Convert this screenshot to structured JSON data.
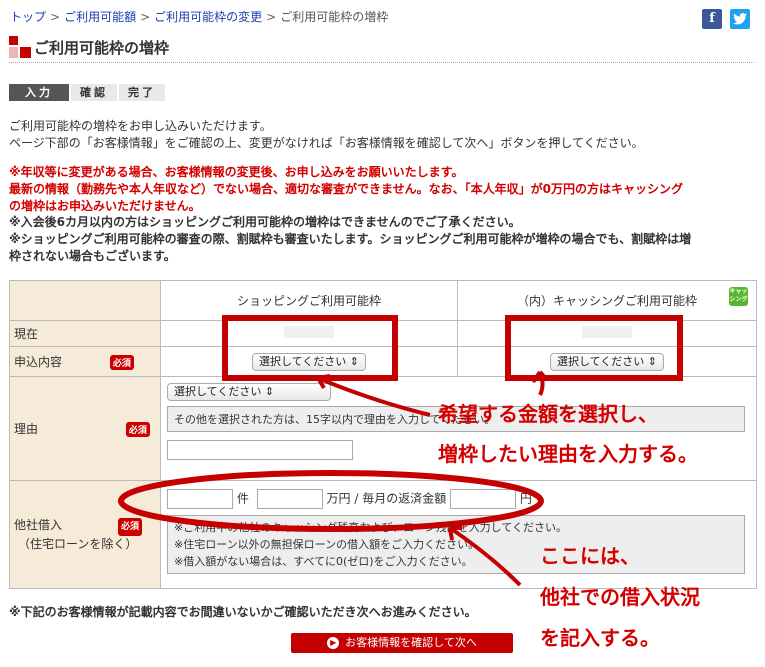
{
  "breadcrumb": {
    "items": [
      {
        "label": "トップ",
        "link": true
      },
      {
        "label": "ご利用可能額",
        "link": true
      },
      {
        "label": "ご利用可能枠の変更",
        "link": true
      },
      {
        "label": "ご利用可能枠の増枠",
        "link": false
      }
    ],
    "separator": ">"
  },
  "social": {
    "facebook": "f",
    "twitter": "t"
  },
  "page_title": "ご利用可能枠の増枠",
  "steps": [
    "入力",
    "確認",
    "完了"
  ],
  "intro": [
    "ご利用可能枠の増枠をお申し込みいただけます。",
    "ページ下部の「お客様情報」をご確認の上、変更がなければ「お客様情報を確認して次へ」ボタンを押してください。"
  ],
  "warnings": [
    "※年収等に変更がある場合、お客様情報の変更後、お申し込みをお願いいたします。",
    "最新の情報（勤務先や本人年収など）でない場合、適切な審査ができません。なお、「本人年収」が0万円の方はキャッシング",
    "の増枠はお申込みいただけません。"
  ],
  "notes": [
    "※入会後6カ月以内の方はショッピングご利用可能枠の増枠はできませんのでご了承ください。",
    "※ショッピングご利用可能枠の審査の際、割賦枠も審査いたします。ショッピングご利用可能枠が増枠の場合でも、割賦枠は増",
    "枠されない場合もございます。"
  ],
  "table": {
    "col_shopping": "ショッピングご利用可能枠",
    "col_cashing": "（内）キャッシングご利用可能枠",
    "cashing_badge": "キャッシング",
    "row_current": "現在",
    "row_apply": "申込内容",
    "row_reason": "理由",
    "row_other": "他社借入",
    "row_other_sub": "（住宅ローンを除く）",
    "required": "必須",
    "select_placeholder": "選択してください",
    "reason_note": "その他を選択された方は、15字以内で理由を入力してください。",
    "unit_ken": "件",
    "unit_man": "万円",
    "monthly_label": "/ 毎月の返済金額",
    "unit_yen": "円",
    "other_notes": [
      "※ご利用中の他社のキャッシング残高および、ローン残高を入力してください。",
      "※住宅ローン以外の無担保ローンの借入額をご入力ください。",
      "※借入額がない場合は、すべてに0(ゼロ)をご入力ください。"
    ]
  },
  "bottom_note": "※下記のお客様情報が記載内容でお間違いないかご確認いただき次へお進みください。",
  "confirm_button": "お客様情報を確認して次へ",
  "annotations": {
    "line1": "希望する金額を選択し、",
    "line2": "増枠したい理由を入力する。",
    "line3": "ここには、",
    "line4": "他社での借入状況",
    "line5": "を記入する。"
  },
  "colors": {
    "accent_red": "#c40000",
    "label_bg": "#f6ead8",
    "link": "#1a3fb0"
  }
}
